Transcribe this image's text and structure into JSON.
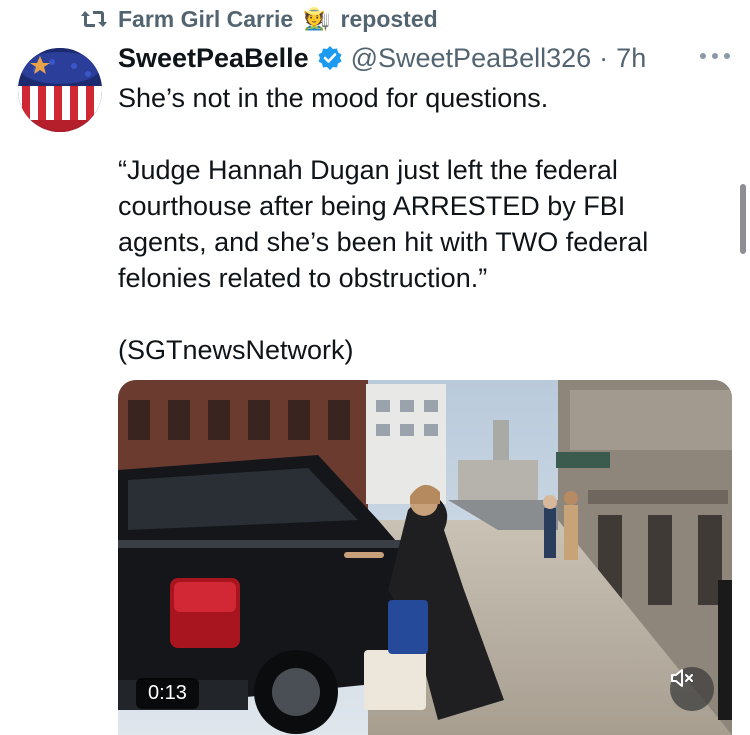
{
  "repost": {
    "reposter_name": "Farm Girl Carrie",
    "reposter_emoji": "🧑‍🌾",
    "label": "reposted"
  },
  "post": {
    "display_name": "SweetPeaBelle",
    "handle": "@SweetPeaBell326",
    "separator": "·",
    "time": "7h",
    "text_lines": [
      "She’s not in the mood for questions.",
      "“Judge Hannah Dugan just left the federal",
      "courthouse after being ARRESTED by FBI",
      "agents, and she’s been hit with TWO federal",
      "felonies related to obstruction.”",
      "(SGTnewsNetwork)"
    ]
  },
  "media": {
    "duration": "0:13",
    "muted": true
  },
  "icons": {
    "repost": "repost-icon",
    "verified": "verified-badge-icon",
    "more": "more-options-icon",
    "mute": "speaker-muted-icon"
  },
  "colors": {
    "secondary_text": "#536471",
    "primary_text": "#0f1419",
    "verified_blue": "#1d9bf0"
  }
}
